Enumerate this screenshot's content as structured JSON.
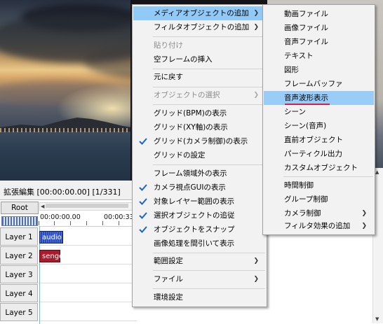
{
  "timeline": {
    "title": "拡張編集 [00:00:00.00] [1/331]",
    "root_label": "Root",
    "ruler_start": "00:00:00.00",
    "ruler_next": "00:00:33.",
    "layers": [
      "Layer 1",
      "Layer 2",
      "Layer 3",
      "Layer 4",
      "Layer 5"
    ],
    "clips": {
      "audio": "audio",
      "senge": "senge"
    },
    "colors": {
      "audio_clip": "#2a4ab8",
      "senge_clip": "#a81c2c",
      "cursor": "#5cc8d8"
    }
  },
  "context_menu": {
    "items": [
      {
        "label": "メディアオブジェクトの追加",
        "submenu": true,
        "highlighted": true
      },
      {
        "label": "フィルタオブジェクトの追加",
        "submenu": true
      },
      {
        "label": "貼り付け",
        "disabled": true
      },
      {
        "label": "空フレームの挿入"
      },
      {
        "label": "元に戻す"
      },
      {
        "label": "オブジェクトの選択",
        "submenu": true,
        "disabled": true
      },
      {
        "label": "グリッド(BPM)の表示"
      },
      {
        "label": "グリッド(XY軸)の表示"
      },
      {
        "label": "グリッド(カメラ制御)の表示",
        "checked": true
      },
      {
        "label": "グリッドの設定"
      },
      {
        "label": "フレーム領域外の表示"
      },
      {
        "label": "カメラ視点GUIの表示",
        "checked": true
      },
      {
        "label": "対象レイヤー範囲の表示",
        "checked": true
      },
      {
        "label": "選択オブジェクトの追従",
        "checked": true
      },
      {
        "label": "オブジェクトをスナップ",
        "checked": true
      },
      {
        "label": "画像処理を間引いて表示"
      },
      {
        "label": "範囲設定",
        "submenu": true
      },
      {
        "label": "ファイル",
        "submenu": true
      },
      {
        "label": "環境設定"
      }
    ]
  },
  "media_submenu": {
    "items": [
      {
        "label": "動画ファイル"
      },
      {
        "label": "画像ファイル"
      },
      {
        "label": "音声ファイル"
      },
      {
        "label": "テキスト"
      },
      {
        "label": "図形"
      },
      {
        "label": "フレームバッファ"
      },
      {
        "label": "音声波形表示",
        "highlighted": true
      },
      {
        "label": "シーン"
      },
      {
        "label": "シーン(音声)"
      },
      {
        "label": "直前オブジェクト"
      },
      {
        "label": "パーティクル出力"
      },
      {
        "label": "カスタムオブジェクト"
      },
      {
        "label": "時間制御"
      },
      {
        "label": "グループ制御"
      },
      {
        "label": "カメラ制御",
        "submenu": true
      },
      {
        "label": "フィルタ効果の追加",
        "submenu": true
      }
    ],
    "underline_color": "#e8193c",
    "highlight_color": "#99cdf8"
  }
}
